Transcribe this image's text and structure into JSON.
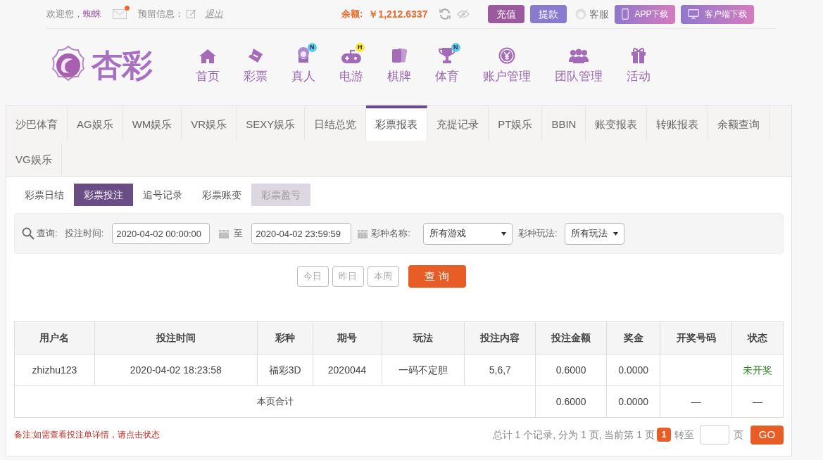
{
  "top_bar": {
    "welcome_label": "欢迎您，",
    "username": "蜘蛛",
    "has_message": true,
    "reserved_label": "预留信息：",
    "logout": "退出",
    "balance_label": "余额:",
    "balance": "￥1,212.6337",
    "buttons": [
      {
        "label": "充值",
        "kind": "deposit"
      },
      {
        "label": "提款",
        "kind": "withdraw"
      },
      {
        "label": "客服",
        "kind": "service"
      },
      {
        "label": "APP下载",
        "kind": "app"
      },
      {
        "label": "客户端下载",
        "kind": "client"
      }
    ]
  },
  "logo": {
    "text": "杏彩"
  },
  "nav": [
    {
      "label": "首页",
      "kind": "home"
    },
    {
      "label": "彩票",
      "kind": "ticket"
    },
    {
      "label": "真人",
      "kind": "live",
      "badge": "N",
      "color": "#5bc8f0"
    },
    {
      "label": "电游",
      "kind": "game",
      "badge": "H",
      "color": "#f5e63a"
    },
    {
      "label": "棋牌",
      "kind": "cards"
    },
    {
      "label": "体育",
      "kind": "trophy",
      "badge": "N",
      "color": "#5bc8f0"
    },
    {
      "label": "账户管理",
      "kind": "yen"
    },
    {
      "label": "团队管理",
      "kind": "team"
    },
    {
      "label": "活动",
      "kind": "gift"
    }
  ],
  "tabs": [
    {
      "label": "沙巴体育",
      "selected": false
    },
    {
      "label": "AG娱乐",
      "selected": false
    },
    {
      "label": "WM娱乐",
      "selected": false
    },
    {
      "label": "VR娱乐",
      "selected": false
    },
    {
      "label": "SEXY娱乐",
      "selected": false
    },
    {
      "label": "日结总览",
      "selected": false
    },
    {
      "label": "彩票报表",
      "selected": true
    },
    {
      "label": "充提记录",
      "selected": false
    },
    {
      "label": "PT娱乐",
      "selected": false
    },
    {
      "label": "BBIN",
      "selected": false
    },
    {
      "label": "账变报表",
      "selected": false
    },
    {
      "label": "转账报表",
      "selected": false
    },
    {
      "label": "余额查询",
      "selected": false
    },
    {
      "label": "VG娱乐",
      "selected": false
    }
  ],
  "sub_tabs": [
    {
      "label": "彩票日结",
      "selected": false,
      "disabled": false
    },
    {
      "label": "彩票投注",
      "selected": true,
      "disabled": false
    },
    {
      "label": "追号记录",
      "selected": false,
      "disabled": false
    },
    {
      "label": "彩票账变",
      "selected": false,
      "disabled": false
    },
    {
      "label": "彩票盈亏",
      "selected": false,
      "disabled": true
    }
  ],
  "filter": {
    "query_label": "查询:",
    "time_label": "投注时间:",
    "start": "2020-04-02 00:00:00",
    "to": "至",
    "end": "2020-04-02 23:59:59",
    "game_label": "彩种名称:",
    "game_value": "所有游戏",
    "play_label": "彩种玩法:",
    "play_value": "所有玩法"
  },
  "quick_buttons": [
    "今日",
    "昨日",
    "本周"
  ],
  "search_button": "查 询",
  "table": {
    "columns": [
      "用户名",
      "投注时间",
      "彩种",
      "期号",
      "玩法",
      "投注内容",
      "投注金额",
      "奖金",
      "开奖号码",
      "状态"
    ],
    "rows": [
      {
        "cells": [
          "zhizhu123",
          "2020-04-02 18:23:58",
          "福彩3D",
          "2020044",
          "一码不定胆",
          "5,6,7",
          "0.6000",
          "0.0000",
          "",
          "未开奖"
        ]
      }
    ],
    "total": {
      "label": "本页合计",
      "values": [
        "0.6000",
        "0.0000",
        "—",
        "—"
      ]
    }
  },
  "note": "备注:如需查看投注单详情，请点击状态",
  "pagination": {
    "summary": "总计 1 个记录, 分为 1 页, 当前第 1 页",
    "current": "1",
    "goto_label": "转至",
    "page_label": "页",
    "go": "GO"
  }
}
